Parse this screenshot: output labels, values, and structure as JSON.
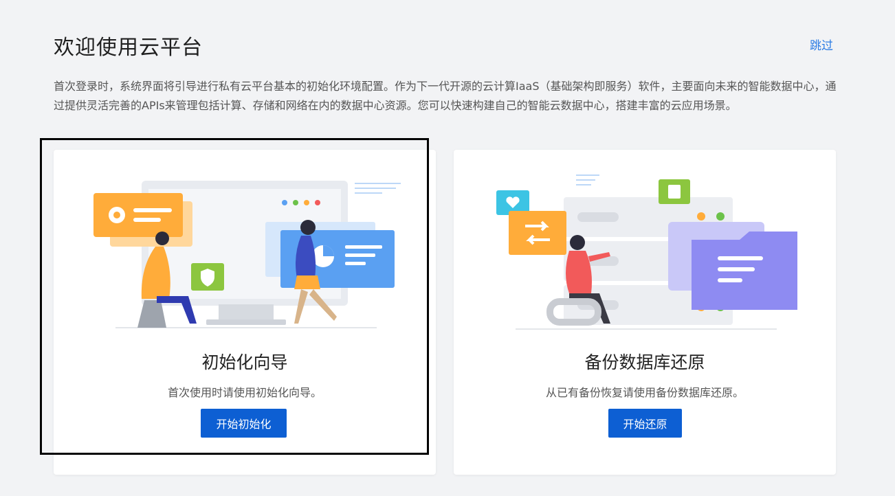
{
  "header": {
    "title": "欢迎使用云平台",
    "skip_label": "跳过"
  },
  "intro": {
    "text": "首次登录时，系统界面将引导进行私有云平台基本的初始化环境配置。作为下一代开源的云计算IaaS（基础架构即服务）软件，主要面向未来的智能数据中心，通过提供灵活完善的APIs来管理包括计算、存储和网络在内的数据中心资源。您可以快速构建自己的智能云数据中心，搭建丰富的云应用场景。"
  },
  "cards": [
    {
      "title": "初始化向导",
      "description": "首次使用时请使用初始化向导。",
      "button_label": "开始初始化",
      "highlighted": true
    },
    {
      "title": "备份数据库还原",
      "description": "从已有备份恢复请使用备份数据库还原。",
      "button_label": "开始还原",
      "highlighted": false
    }
  ],
  "colors": {
    "accent": "#0d5fd3",
    "link": "#2a7be4",
    "orange": "#ffac3a",
    "blue_panel": "#5aa0f2",
    "purple_folder": "#8e8bf2",
    "green": "#8cc63f",
    "cyan": "#3cc4e4"
  },
  "icons": {
    "card1_illustration": "setup-wizard-illustration",
    "card2_illustration": "database-restore-illustration"
  }
}
